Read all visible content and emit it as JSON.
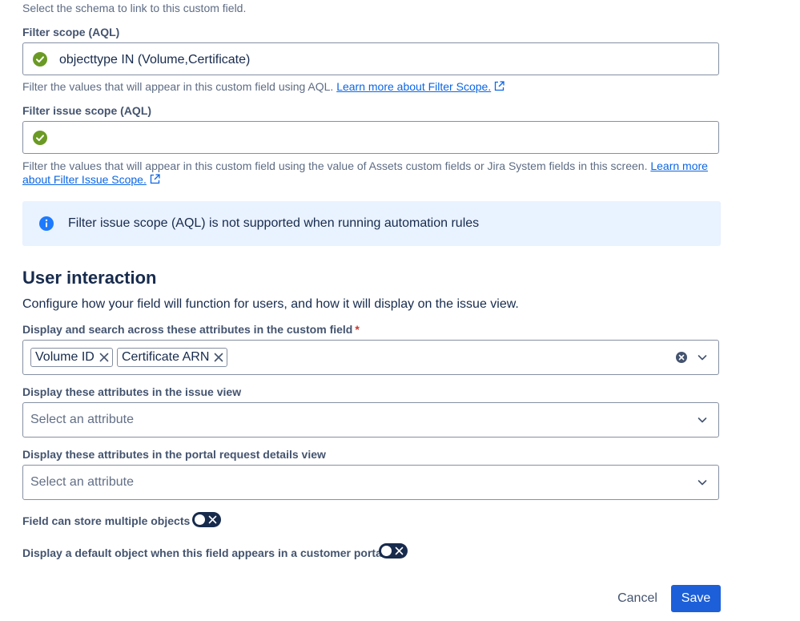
{
  "schema": {
    "helper": "Select the schema to link to this custom field."
  },
  "filter_scope": {
    "label": "Filter scope (AQL)",
    "value": "objecttype IN (Volume,Certificate)",
    "helper_text": "Filter the values that will appear in this custom field using AQL.",
    "helper_link": "Learn more about Filter Scope."
  },
  "filter_issue_scope": {
    "label": "Filter issue scope (AQL)",
    "value": "",
    "helper_text": "Filter the values that will appear in this custom field using the value of Assets custom fields or Jira System fields in this screen.",
    "helper_link_line1": "Learn more",
    "helper_link_line2": "about Filter Issue Scope."
  },
  "info_banner": {
    "text": "Filter issue scope (AQL) is not supported when running automation rules"
  },
  "user_interaction": {
    "title": "User interaction",
    "description": "Configure how your field will function for users, and how it will display on the issue view."
  },
  "display_search": {
    "label": "Display and search across these attributes in the custom field",
    "required_mark": "*",
    "tags": [
      "Volume ID",
      "Certificate ARN"
    ]
  },
  "issue_view": {
    "label": "Display these attributes in the issue view",
    "placeholder": "Select an attribute"
  },
  "portal_view": {
    "label": "Display these attributes in the portal request details view",
    "placeholder": "Select an attribute"
  },
  "multiple_objects": {
    "label": "Field can store multiple objects",
    "enabled": false
  },
  "default_object": {
    "label": "Display a default object when this field appears in a customer portal",
    "enabled": false
  },
  "actions": {
    "cancel": "Cancel",
    "save": "Save"
  },
  "colors": {
    "link": "#0c66e4",
    "success": "#6a9a23",
    "info_bg": "#e9f2ff",
    "info_icon": "#1d7afc",
    "primary_button": "#1d5fd8",
    "toggle_off": "#172b4d"
  }
}
